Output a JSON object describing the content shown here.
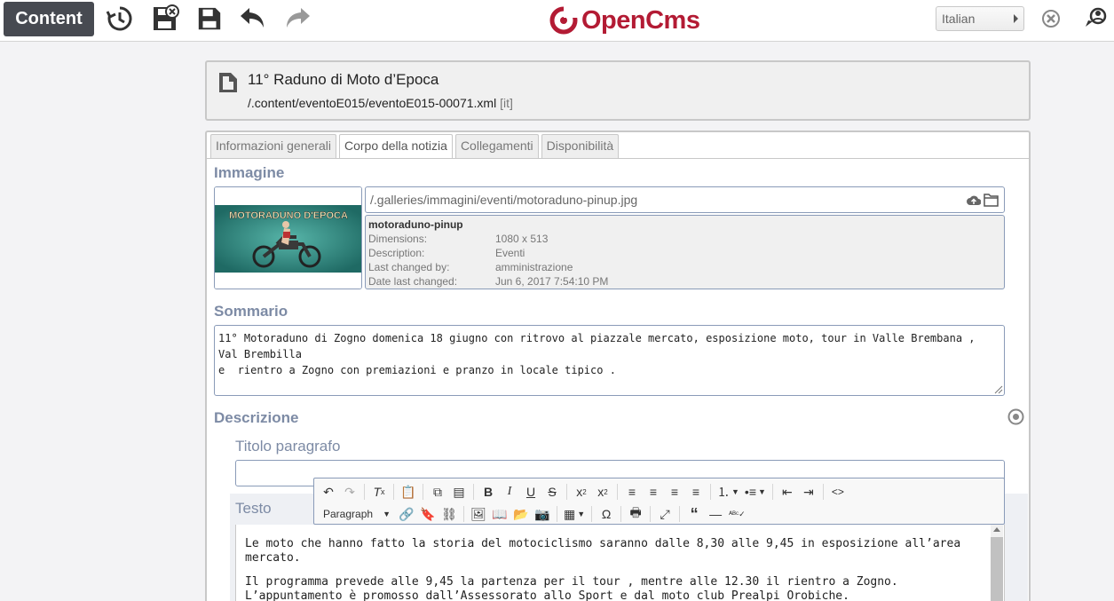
{
  "toolbar": {
    "content_label": "Content",
    "icons": [
      "history-icon",
      "save-exit-icon",
      "save-icon",
      "undo-icon",
      "redo-icon"
    ],
    "brand": "OpenCms",
    "language": "Italian"
  },
  "header": {
    "title": "11° Raduno di Moto d’Epoca",
    "path": "/.content/eventoE015/eventoE015-00071.xml",
    "locale": "[it]"
  },
  "tabs": [
    {
      "label": "Informazioni generali"
    },
    {
      "label": "Corpo della notizia"
    },
    {
      "label": "Collegamenti"
    },
    {
      "label": "Disponibilità"
    }
  ],
  "image": {
    "label": "Immagine",
    "path": "/.galleries/immagini/eventi/motoraduno-pinup.jpg",
    "banner_text": "MOTORADUNO D'EPOCA",
    "name": "motoraduno-pinup",
    "fields": [
      {
        "key": "Dimensions:",
        "value": "1080 x 513"
      },
      {
        "key": "Description:",
        "value": "Eventi"
      },
      {
        "key": "Last changed by:",
        "value": "amministrazione"
      },
      {
        "key": "Date last changed:",
        "value": "Jun 6, 2017 7:54:10 PM"
      }
    ]
  },
  "summary": {
    "label": "Sommario",
    "text": "11° Motoraduno di Zogno domenica 18 giugno con ritrovo al piazzale mercato, esposizione moto, tour in Valle Brembana , Val Brembilla\ne  rientro a Zogno con premiazioni e pranzo in locale tipico ."
  },
  "description": {
    "label": "Descrizione",
    "paragraph_title_label": "Titolo paragrafo",
    "text_label": "Testo",
    "format_label": "Paragraph",
    "paragraphs": [
      "Le moto che hanno fatto la storia del motociclismo saranno dalle 8,30 alle 9,45 in esposizione all’area mercato.",
      "Il programma prevede alle 9,45 la partenza per il tour , mentre alle 12.30 il rientro a Zogno. L’appuntamento è promosso dall’Assessorato allo Sport e dal moto club Prealpi Orobiche."
    ]
  },
  "colors": {
    "brand": "#b31b34",
    "label": "#7d8ba5",
    "content_button": "#474a51"
  }
}
